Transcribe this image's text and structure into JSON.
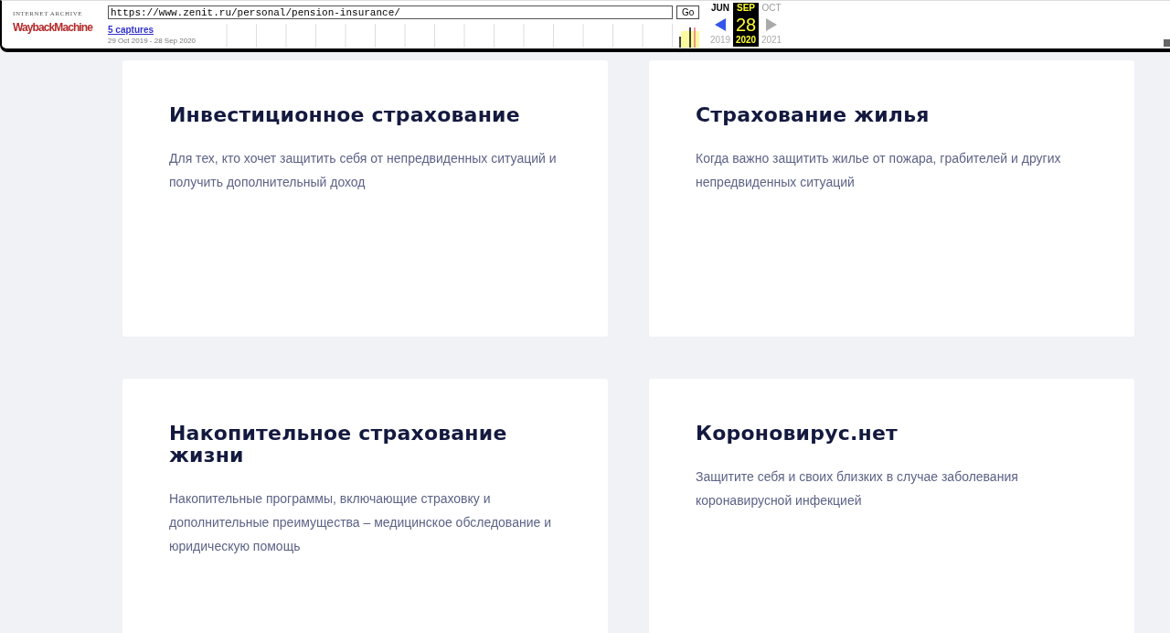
{
  "toolbar": {
    "logo_top": "INTERNET ARCHIVE",
    "logo_main": "WaybackMachine",
    "url": "https://www.zenit.ru/personal/pension-insurance/",
    "go": "Go",
    "captures": "5 captures",
    "date_range": "29 Oct 2019 - 28 Sep 2020",
    "calendar": {
      "months": [
        {
          "label": "JUN",
          "selected": false
        },
        {
          "label": "SEP",
          "selected": true
        },
        {
          "label": "OCT",
          "selected": false
        }
      ],
      "day": "28",
      "years": [
        {
          "label": "2019",
          "selected": false
        },
        {
          "label": "2020",
          "selected": true
        },
        {
          "label": "2021",
          "selected": false
        }
      ]
    }
  },
  "cards": [
    {
      "title": "Инвестиционное страхование",
      "text": "Для тех, кто хочет защитить себя от непредвиденных ситуаций и получить дополнительный доход"
    },
    {
      "title": "Страхование жилья",
      "text": "Когда важно защитить жилье от пожара, грабителей и других непредвиденных ситуаций"
    },
    {
      "title": "Накопительное страхование жизни",
      "text": "Накопительные программы, включающие страховку и дополнительные преимущества – медицинское обследование и юридическую помощь"
    },
    {
      "title": "Короновирус.нет",
      "text": "Защитите себя и своих близких в случае заболевания коронавирусной инфекцией"
    }
  ]
}
